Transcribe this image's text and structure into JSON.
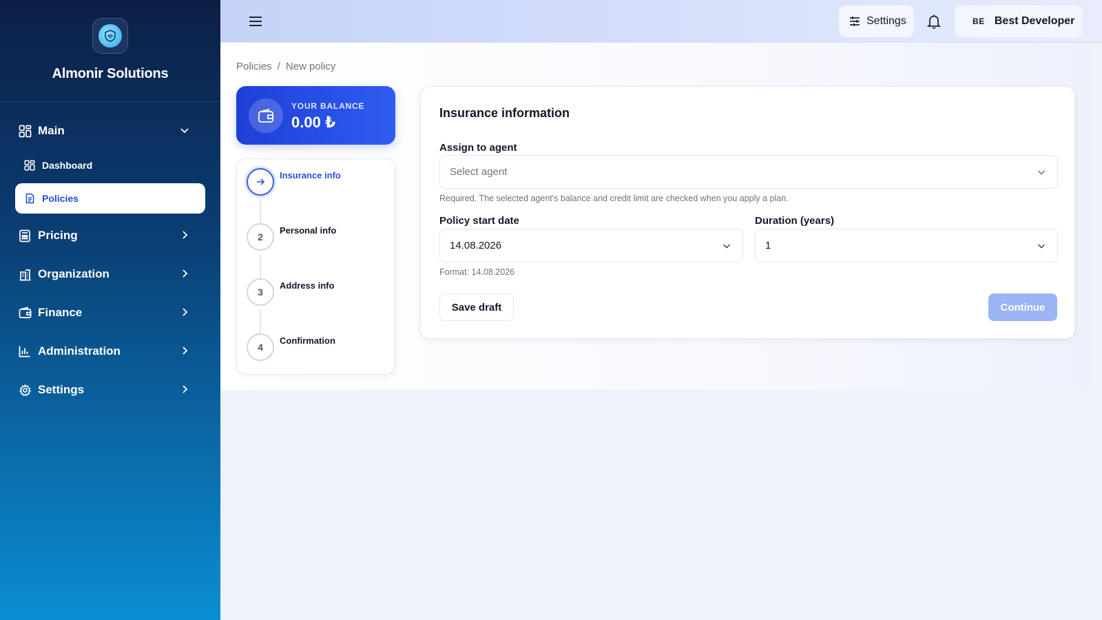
{
  "brand": {
    "name": "Almonir Solutions",
    "logo_icon": "shield-wave-icon"
  },
  "sidebar": {
    "items": [
      {
        "label": "Main",
        "icon": "grid-icon",
        "chevron": "chevron-down-icon"
      },
      {
        "label": "Dashboard",
        "icon": "grid-icon"
      },
      {
        "label": "Policies",
        "icon": "document-icon",
        "active": true
      },
      {
        "label": "Pricing",
        "icon": "calculator-icon",
        "chevron": "chevron-right-icon"
      },
      {
        "label": "Organization",
        "icon": "building-icon",
        "chevron": "chevron-right-icon"
      },
      {
        "label": "Finance",
        "icon": "wallet-icon",
        "chevron": "chevron-right-icon"
      },
      {
        "label": "Administration",
        "icon": "bar-chart-icon",
        "chevron": "chevron-right-icon"
      },
      {
        "label": "Settings",
        "icon": "gear-icon",
        "chevron": "chevron-right-icon"
      }
    ]
  },
  "header": {
    "settings_label": "Settings",
    "user_initials": "BE",
    "user_name": "Best Developer"
  },
  "breadcrumb": {
    "parent": "Policies",
    "separator": "/",
    "current": "New policy"
  },
  "balance": {
    "label": "YOUR BALANCE",
    "value": "0.00 ₺"
  },
  "steps": [
    {
      "marker": "→",
      "label": "Insurance info",
      "active": true
    },
    {
      "marker": "2",
      "label": "Personal info"
    },
    {
      "marker": "3",
      "label": "Address info"
    },
    {
      "marker": "4",
      "label": "Confirmation"
    }
  ],
  "form": {
    "title": "Insurance information",
    "agent_label": "Assign to agent",
    "agent_placeholder": "Select agent",
    "agent_hint": "Required. The selected agent's balance and credit limit are checked when you apply a plan.",
    "start_date_label": "Policy start date",
    "start_date_value": "14.08.2026",
    "start_date_hint": "Format: 14.08.2026",
    "duration_label": "Duration (years)",
    "duration_value": "1",
    "save_draft_label": "Save draft",
    "continue_label": "Continue"
  },
  "colors": {
    "accent": "#2451d6",
    "balance_bg": "#1e40d8",
    "continue_disabled": "#9bb4f6",
    "sidebar_top": "#0c1f45",
    "sidebar_bottom": "#0a8ed2"
  }
}
